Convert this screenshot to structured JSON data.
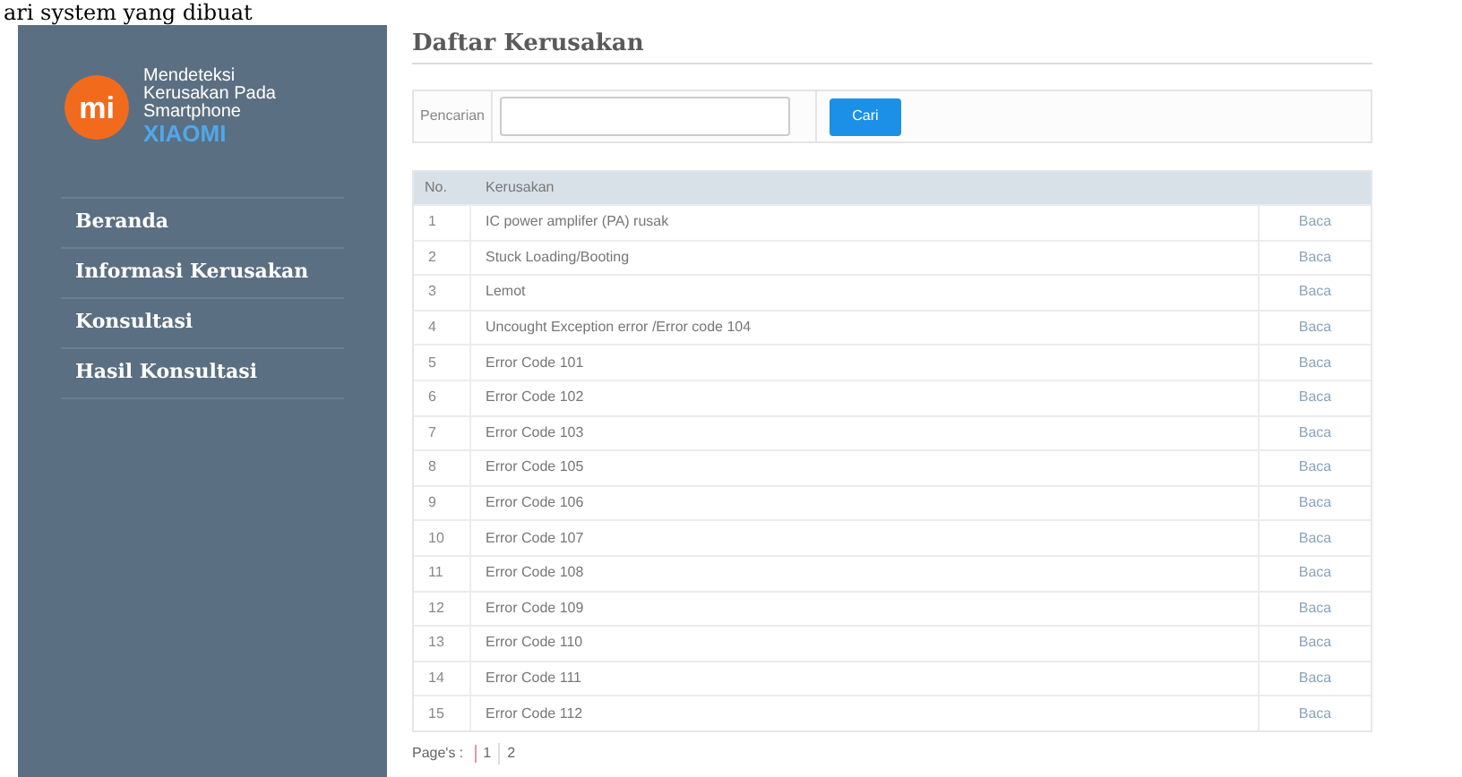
{
  "caption": "ari system yang dibuat",
  "sidebar": {
    "logo_text": "mi",
    "subtitle": "Mendeteksi Kerusakan Pada Smartphone",
    "brand": "XIAOMI",
    "items": [
      {
        "label": "Beranda"
      },
      {
        "label": "Informasi Kerusakan"
      },
      {
        "label": "Konsultasi"
      },
      {
        "label": "Hasil Konsultasi"
      }
    ]
  },
  "title": "Daftar Kerusakan",
  "search": {
    "label": "Pencarian",
    "button": "Cari"
  },
  "table": {
    "columns": [
      "No.",
      "Kerusakan"
    ],
    "rows": [
      {
        "no": "1",
        "name": "IC power amplifer (PA) rusak",
        "action": "Baca"
      },
      {
        "no": "2",
        "name": "Stuck Loading/Booting",
        "action": "Baca"
      },
      {
        "no": "3",
        "name": "Lemot",
        "action": "Baca"
      },
      {
        "no": "4",
        "name": "Uncought Exception error /Error code 104",
        "action": "Baca"
      },
      {
        "no": "5",
        "name": "Error Code 101",
        "action": "Baca"
      },
      {
        "no": "6",
        "name": "Error Code 102",
        "action": "Baca"
      },
      {
        "no": "7",
        "name": "Error Code 103",
        "action": "Baca"
      },
      {
        "no": "8",
        "name": "Error Code 105",
        "action": "Baca"
      },
      {
        "no": "9",
        "name": "Error Code 106",
        "action": "Baca"
      },
      {
        "no": "10",
        "name": "Error Code 107",
        "action": "Baca"
      },
      {
        "no": "11",
        "name": "Error Code 108",
        "action": "Baca"
      },
      {
        "no": "12",
        "name": "Error Code 109",
        "action": "Baca"
      },
      {
        "no": "13",
        "name": "Error Code 110",
        "action": "Baca"
      },
      {
        "no": "14",
        "name": "Error Code 111",
        "action": "Baca"
      },
      {
        "no": "15",
        "name": "Error Code 112",
        "action": "Baca"
      }
    ]
  },
  "pagination": {
    "label": "Page's :",
    "pages": [
      "1",
      "2"
    ]
  }
}
